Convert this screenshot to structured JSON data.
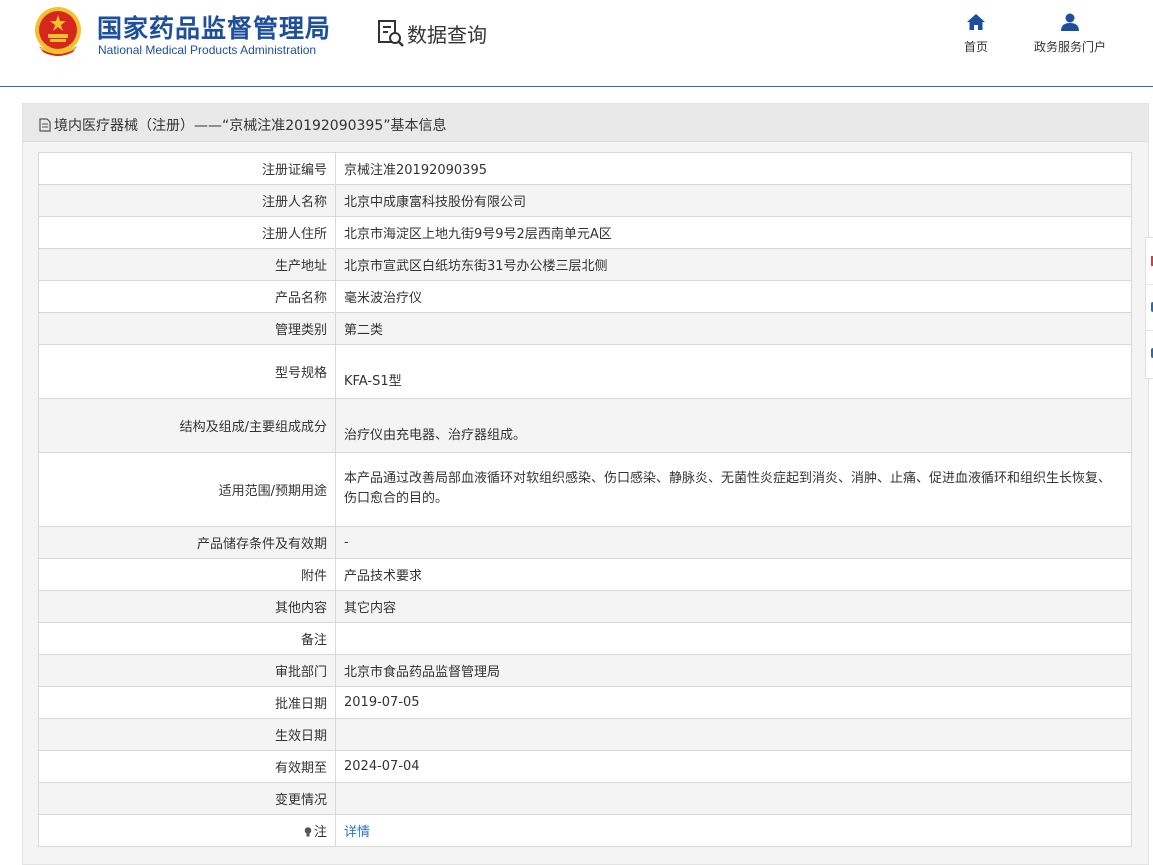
{
  "header": {
    "org_name_cn": "国家药品监督管理局",
    "org_name_en": "National Medical Products Administration",
    "query_label": "数据查询",
    "nav": [
      {
        "label": "首页",
        "icon": "home-icon"
      },
      {
        "label": "政务服务门户",
        "icon": "user-icon"
      }
    ]
  },
  "panel": {
    "title": "境内医疗器械（注册）——“京械注准20192090395”基本信息"
  },
  "fields": [
    {
      "label": "注册证编号",
      "value": "京械注准20192090395"
    },
    {
      "label": "注册人名称",
      "value": "北京中成康富科技股份有限公司"
    },
    {
      "label": "注册人住所",
      "value": "北京市海淀区上地九街9号9号2层西南单元A区"
    },
    {
      "label": "生产地址",
      "value": "北京市宣武区白纸坊东街31号办公楼三层北侧"
    },
    {
      "label": "产品名称",
      "value": "毫米波治疗仪"
    },
    {
      "label": "管理类别",
      "value": "第二类"
    },
    {
      "label": "型号规格",
      "value": "KFA-S1型"
    },
    {
      "label": "结构及组成/主要组成成分",
      "value": "治疗仪由充电器、治疗器组成。"
    },
    {
      "label": "适用范围/预期用途",
      "value": "本产品通过改善局部血液循环对软组织感染、伤口感染、静脉炎、无菌性炎症起到消炎、消肿、止痛、促进血液循环和组织生长恢复、伤口愈合的目的。"
    },
    {
      "label": "产品储存条件及有效期",
      "value": "-"
    },
    {
      "label": "附件",
      "value": "产品技术要求"
    },
    {
      "label": "其他内容",
      "value": "其它内容"
    },
    {
      "label": "备注",
      "value": ""
    },
    {
      "label": "审批部门",
      "value": "北京市食品药品监督管理局"
    },
    {
      "label": "批准日期",
      "value": "2019-07-05"
    },
    {
      "label": "生效日期",
      "value": ""
    },
    {
      "label": "有效期至",
      "value": "2024-07-04"
    },
    {
      "label": "变更情况",
      "value": ""
    },
    {
      "label": "注",
      "value": "详情"
    }
  ],
  "colors": {
    "brand_blue": "#1d4f9c",
    "link_blue": "#2a72c6",
    "emblem_red": "#d7261e",
    "emblem_gold": "#f2c12e"
  }
}
